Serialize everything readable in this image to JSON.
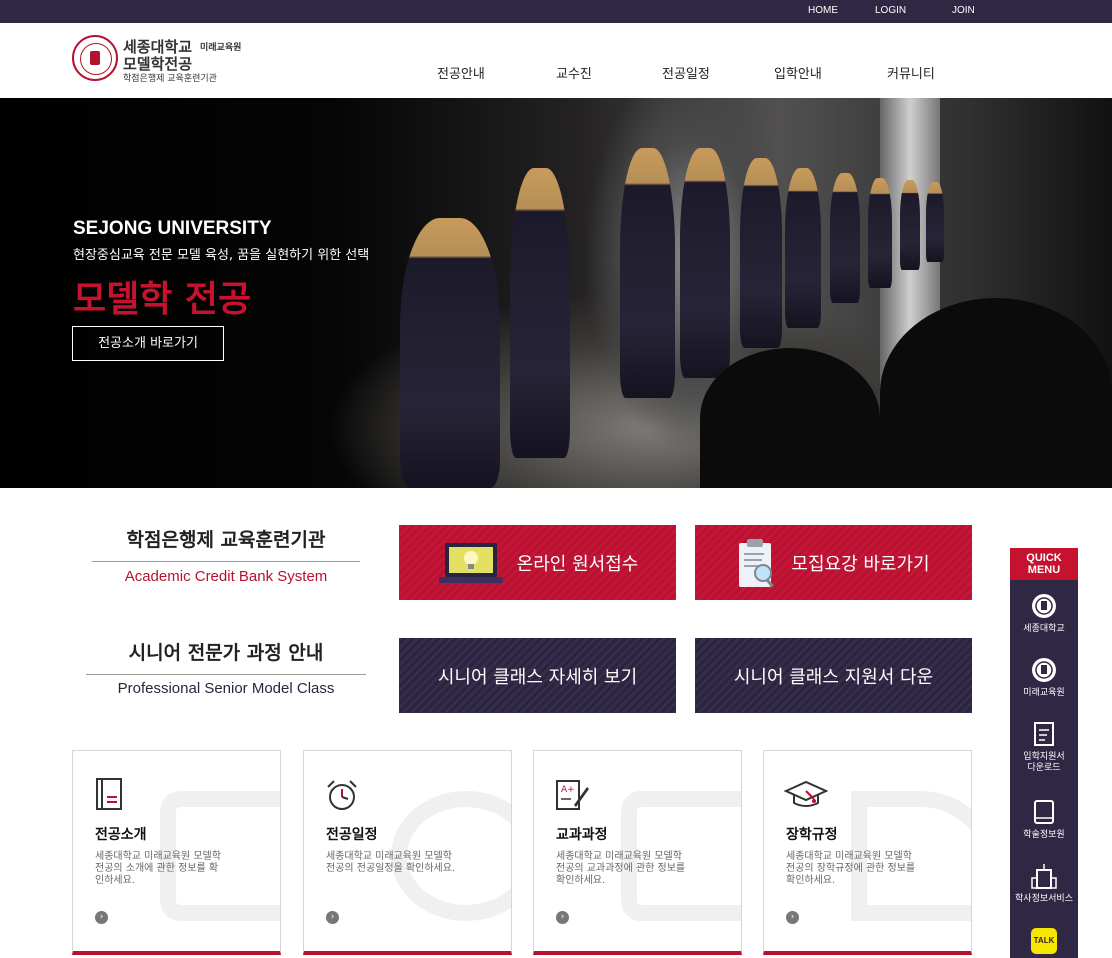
{
  "topbar": {
    "home": "HOME",
    "login": "LOGIN",
    "join": "JOIN"
  },
  "logo": {
    "univ": "세종대학교",
    "school": "미래교육원",
    "major": "모델학전공",
    "tagline": "학점은행제 교육훈련기관"
  },
  "nav": [
    "전공안내",
    "교수진",
    "전공일정",
    "입학안내",
    "커뮤니티"
  ],
  "hero": {
    "title": "SEJONG UNIVERSITY",
    "subtitle": "현장중심교육 전문 모델 육성, 꿈을 실현하기 위한 선택",
    "major": "모델학 전공",
    "button": "전공소개 바로가기"
  },
  "section1": {
    "heading": "학점은행제 교육훈련기관",
    "english": "Academic Credit Bank System",
    "btn_online": "온라인 원서접수",
    "btn_guide": "모집요강 바로가기"
  },
  "section2": {
    "heading": "시니어 전문가 과정 안내",
    "english": "Professional Senior Model Class",
    "btn_detail": "시니어 클래스 자세히 보기",
    "btn_download": "시니어 클래스 지원서 다운"
  },
  "cards": [
    {
      "title": "전공소개",
      "desc": "세종대학교 미래교육원 모델학전공의 소개에 관한 정보를 확인하세요.",
      "icon": "book-icon"
    },
    {
      "title": "전공일정",
      "desc": "세종대학교 미래교육원 모델학전공의 전공일정을 확인하세요.",
      "icon": "alarm-clock-icon"
    },
    {
      "title": "교과과정",
      "desc": "세종대학교 미래교육원 모델학전공의 교과과정에 관한 정보를 확인하세요.",
      "icon": "grade-pencil-icon"
    },
    {
      "title": "장학규정",
      "desc": "세종대학교 미래교육원 모델학전공의 장학규정에 관한 정보를 확인하세요.",
      "icon": "graduation-cap-icon"
    }
  ],
  "quick_menu": {
    "title_1": "QUICK",
    "title_2": "MENU",
    "items": [
      "세종대학교",
      "미래교육원",
      "입학지원서 다운로드",
      "학술정보원",
      "학사정보서비스"
    ],
    "talk": "TALK"
  },
  "colors": {
    "brand_red": "#c4122f",
    "navy": "#302744"
  }
}
